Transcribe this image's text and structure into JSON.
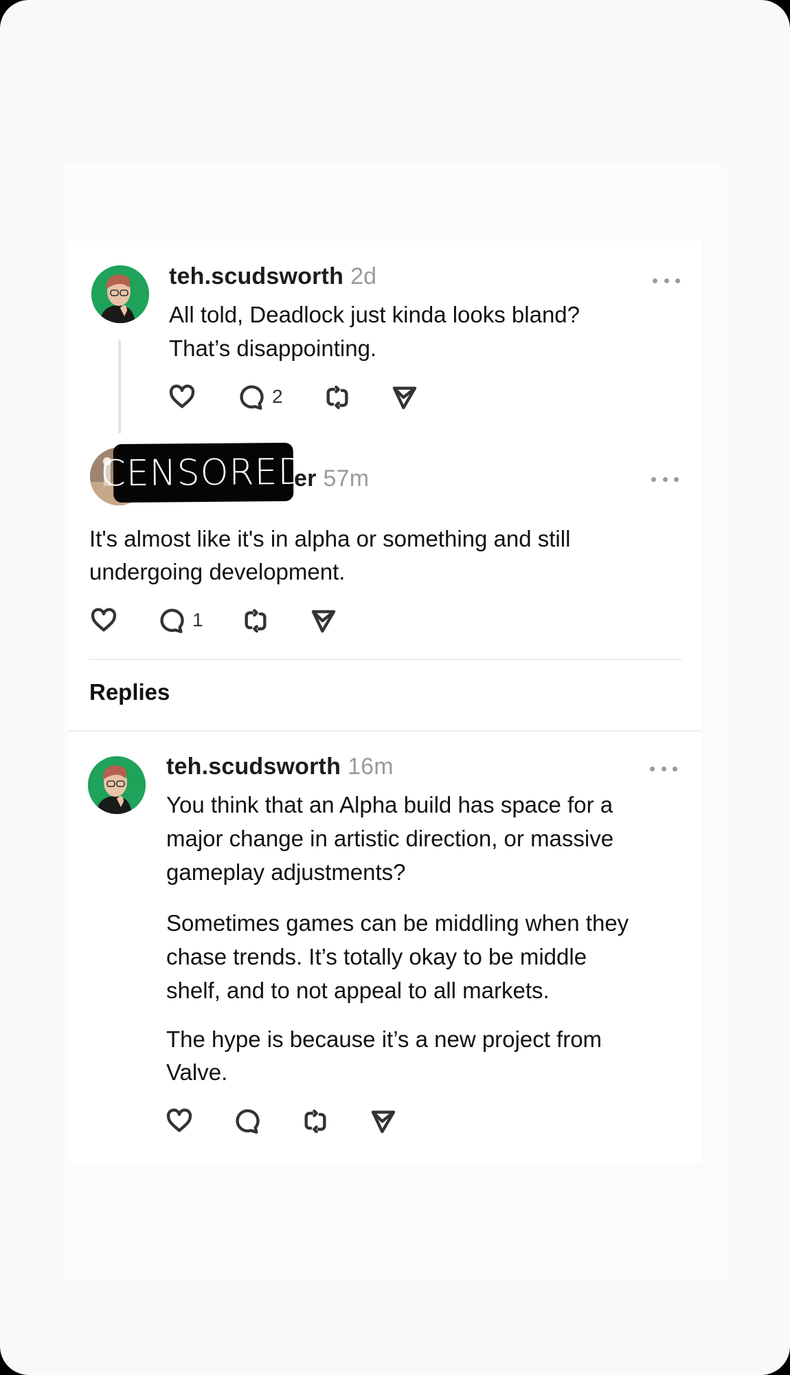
{
  "post": {
    "username": "teh.scudsworth",
    "time": "2d",
    "lines": [
      "All told, Deadlock just kinda looks bland?",
      "That’s disappointing."
    ],
    "actions": {
      "like_icon": "heart-icon",
      "comment_icon": "comment-icon",
      "comment_count": "2",
      "repost_icon": "repost-icon",
      "share_icon": "send-icon"
    },
    "more_icon": "more-options-icon"
  },
  "reply1": {
    "username_visible_suffix": "er",
    "censor_label": "CENSORED",
    "time": "57m",
    "lines": [
      "It's almost like it's in alpha or something and still",
      "undergoing development."
    ],
    "actions": {
      "like_icon": "heart-icon",
      "comment_icon": "comment-icon",
      "comment_count": "1",
      "repost_icon": "repost-icon",
      "share_icon": "send-icon"
    },
    "more_icon": "more-options-icon"
  },
  "replies_section": {
    "title": "Replies"
  },
  "reply2": {
    "username": "teh.scudsworth",
    "time": "16m",
    "paragraphs": [
      [
        "You think that an Alpha build has space for a",
        "major change in artistic direction, or massive",
        "gameplay adjustments?"
      ],
      [
        "Sometimes games can be middling when they",
        "chase trends. It’s totally okay to be middle",
        "shelf, and to not appeal to all markets."
      ],
      [
        "The hype is because it’s a new project from",
        "Valve."
      ]
    ],
    "actions": {
      "like_icon": "heart-icon",
      "comment_icon": "comment-icon",
      "repost_icon": "repost-icon",
      "share_icon": "send-icon"
    },
    "more_icon": "more-options-icon"
  }
}
